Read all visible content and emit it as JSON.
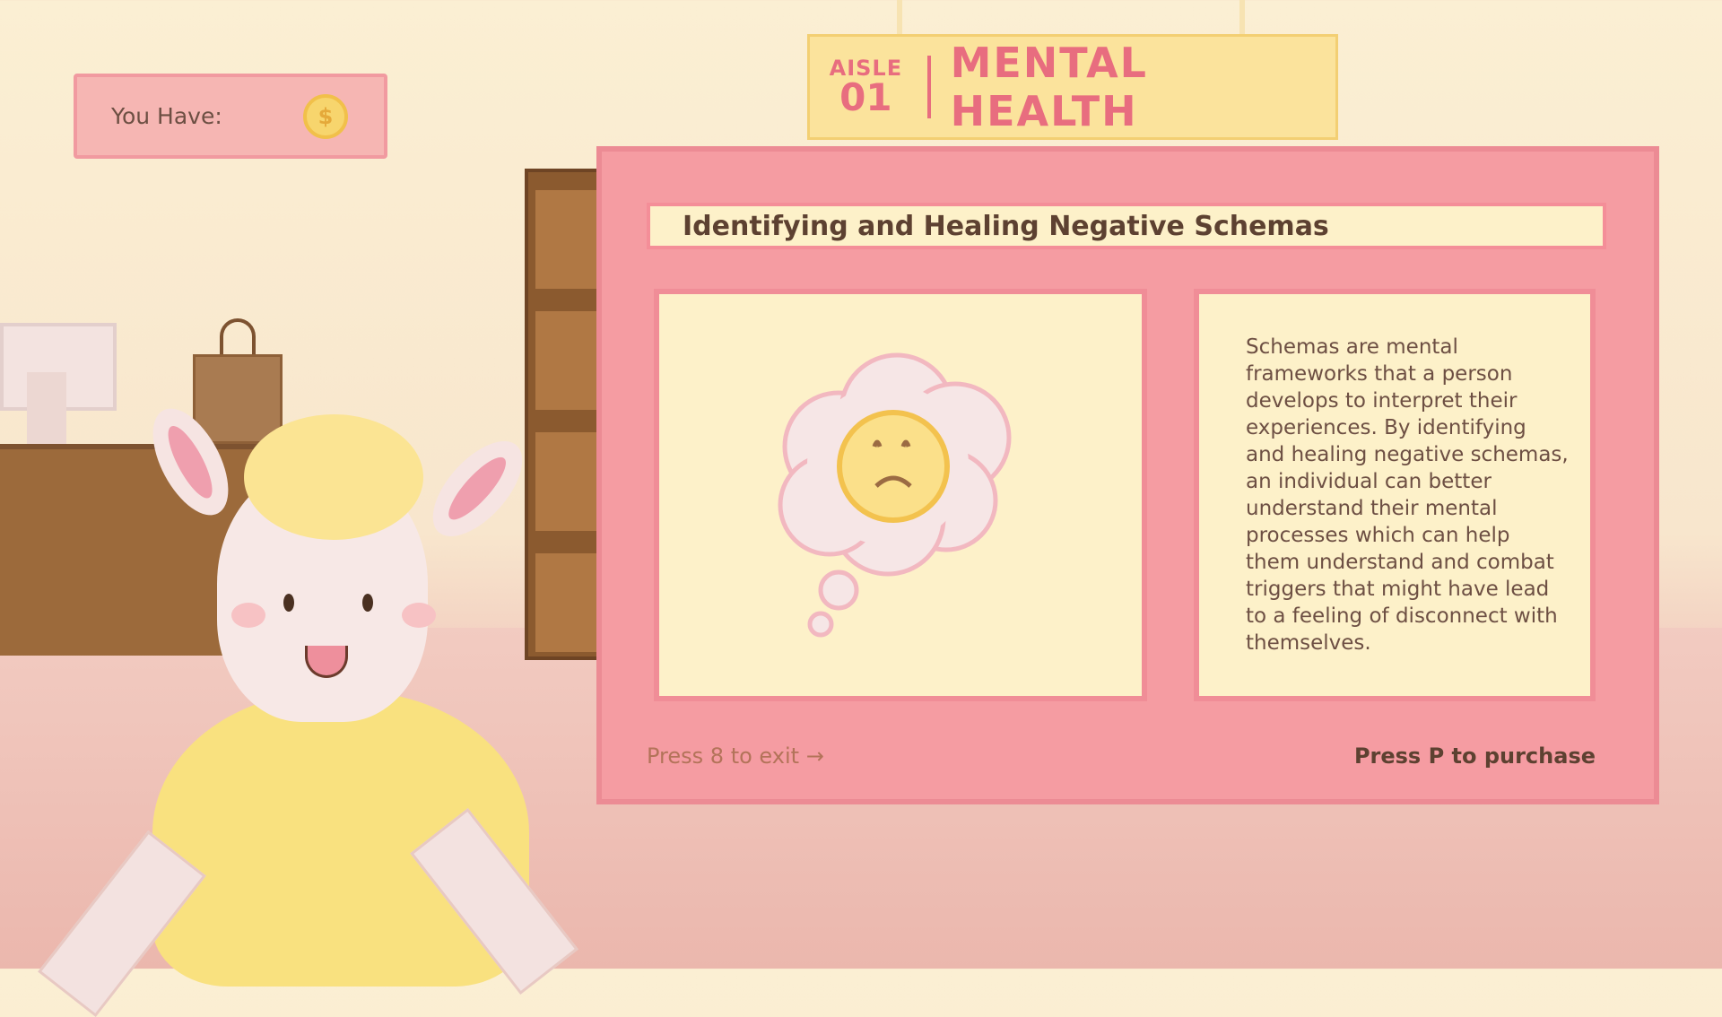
{
  "hud": {
    "wallet_label": "You Have:",
    "wallet_icon": "coin-icon",
    "coin_symbol": "$"
  },
  "aisle_sign": {
    "aisle_word": "AISLE",
    "aisle_number": "01",
    "category": "MENTAL HEALTH"
  },
  "product": {
    "title": "Identifying and Healing Negative Schemas",
    "image_icon": "thought-bubble-sad-face-icon",
    "description": "Schemas are mental frameworks that a person develops to interpret their experiences. By identifying and healing negative schemas, an individual can better understand their mental processes which can help them understand and combat triggers that might have lead to a feeling of disconnect with themselves."
  },
  "controls": {
    "exit_hint": "Press 8 to exit",
    "exit_arrow": "→",
    "purchase_hint": "Press P to purchase"
  },
  "colors": {
    "panel": "#f59ca2",
    "panel_border": "#ec8b94",
    "card": "#fdf1c9",
    "sign": "#fbe39c",
    "sign_text": "#e86d7f",
    "coin": "#f7d56d"
  }
}
